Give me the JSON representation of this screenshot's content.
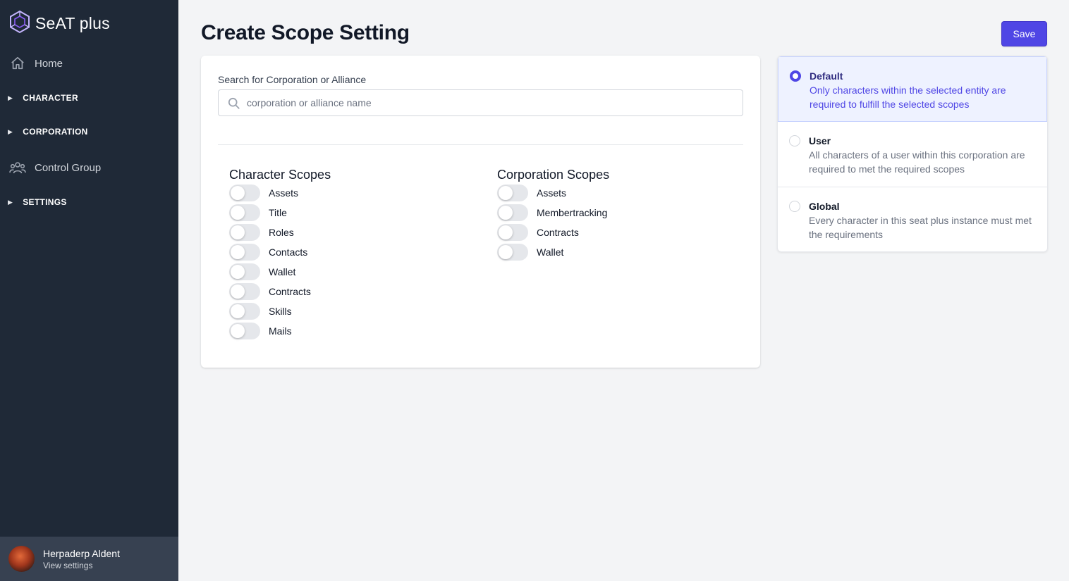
{
  "brand": {
    "name": "SeAT plus"
  },
  "sidebar": {
    "home": "Home",
    "character": "CHARACTER",
    "corporation": "CORPORATION",
    "control_group": "Control Group",
    "settings": "SETTINGS"
  },
  "user": {
    "name": "Herpaderp Aldent",
    "sub": "View settings"
  },
  "page": {
    "title": "Create Scope Setting",
    "save_label": "Save"
  },
  "search": {
    "label": "Search for Corporation or Alliance",
    "placeholder": "corporation or alliance name",
    "value": ""
  },
  "character_scopes": {
    "title": "Character Scopes",
    "items": [
      "Assets",
      "Title",
      "Roles",
      "Contacts",
      "Wallet",
      "Contracts",
      "Skills",
      "Mails"
    ]
  },
  "corporation_scopes": {
    "title": "Corporation Scopes",
    "items": [
      "Assets",
      "Membertracking",
      "Contracts",
      "Wallet"
    ]
  },
  "type_options": [
    {
      "title": "Default",
      "desc": "Only characters within the selected entity are required to fulfill the selected scopes",
      "selected": true
    },
    {
      "title": "User",
      "desc": "All characters of a user within this corporation are required to met the required scopes",
      "selected": false
    },
    {
      "title": "Global",
      "desc": "Every character in this seat plus instance must met the requirements",
      "selected": false
    }
  ],
  "colors": {
    "sidebar": "#1f2937",
    "accent": "#4f46e5",
    "background": "#f3f4f6"
  }
}
